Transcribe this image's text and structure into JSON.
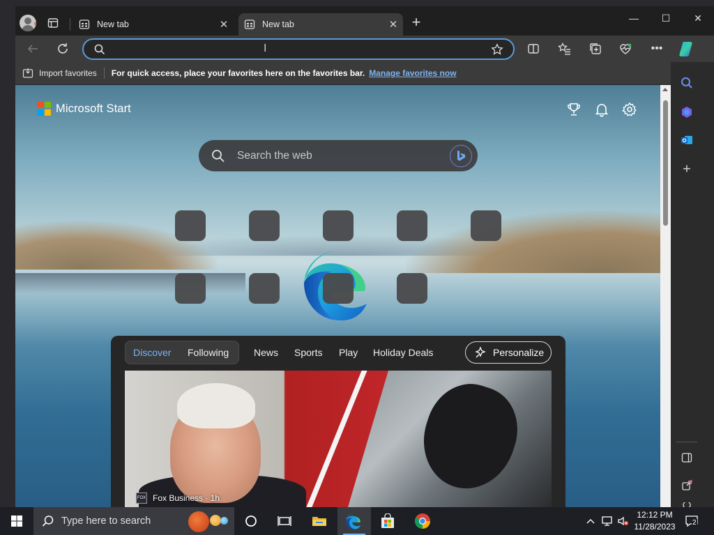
{
  "browser": {
    "tabs": [
      {
        "title": "New tab",
        "close": "✕"
      },
      {
        "title": "New tab",
        "close": "✕"
      }
    ],
    "new_tab": "+",
    "window_controls": {
      "minimize": "—",
      "maximize": "☐",
      "close": "✕"
    },
    "address": {
      "value": "",
      "placeholder": ""
    },
    "favorites_bar": {
      "import_label": "Import favorites",
      "message": "For quick access, place your favorites here on the favorites bar.",
      "link": "Manage favorites now"
    }
  },
  "start_page": {
    "brand": "Microsoft Start",
    "search_placeholder": "Search the web",
    "tiles_row1": 5,
    "tiles_row2": 4,
    "feed": {
      "pill_tabs": [
        "Discover",
        "Following"
      ],
      "tabs": [
        "News",
        "Sports",
        "Play",
        "Holiday Deals"
      ],
      "personalize": "Personalize",
      "hero_source_logo": "FOX",
      "hero_source": "Fox Business · 1h"
    }
  },
  "taskbar": {
    "search_text": "Type here to search",
    "time": "12:12 PM",
    "date": "11/28/2023",
    "notifications_count": "2"
  },
  "colors": {
    "accent": "#7ab4f7",
    "ms_red": "#f25022",
    "ms_green": "#7fba00",
    "ms_blue": "#00a4ef",
    "ms_yellow": "#ffb900"
  }
}
